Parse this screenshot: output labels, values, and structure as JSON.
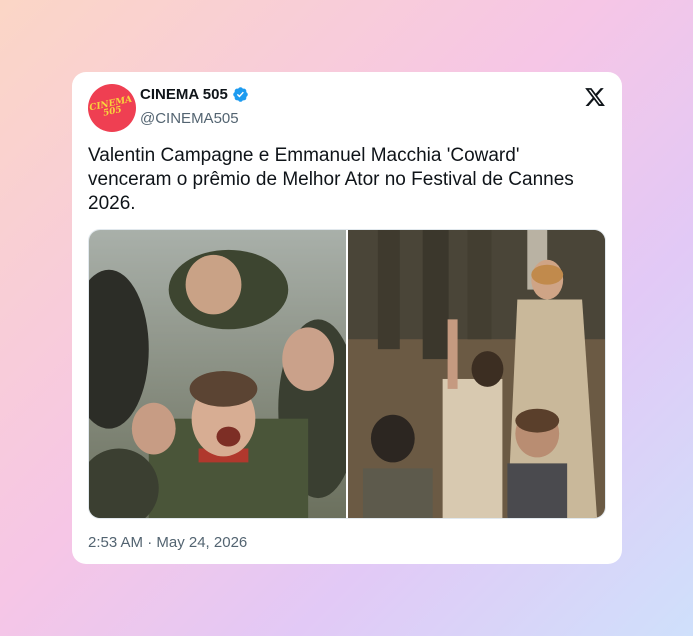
{
  "tweet": {
    "display_name": "CINEMA 505",
    "handle": "@CINEMA505",
    "avatar_text_line1": "CINEMA",
    "avatar_text_line2": "505",
    "text": "Valentin Campagne e Emmanuel Macchia 'Coward' venceram o prêmio de Melhor Ator no Festival de Cannes 2026.",
    "timestamp": "2:53 AM · May 24, 2026"
  },
  "icons": {
    "verified": "verified-badge-icon",
    "platform": "x-logo-icon"
  },
  "colors": {
    "avatar_bg": "#ef3f52",
    "avatar_text": "#f8d43c",
    "verified": "#1d9bf0"
  }
}
